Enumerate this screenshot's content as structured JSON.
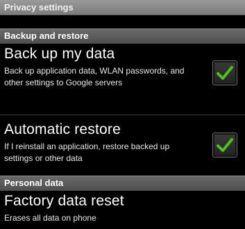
{
  "window": {
    "title": "Privacy settings"
  },
  "sections": [
    {
      "label": "Backup and restore"
    },
    {
      "label": "Personal data"
    }
  ],
  "prefs": {
    "backup": {
      "title": "Back up my data",
      "summary": "Back up application data, WLAN passwords, and other settings to Google servers",
      "checked": true
    },
    "restore": {
      "title": "Automatic restore",
      "summary": "If I reinstall an application, restore backed up settings or other data",
      "checked": true
    },
    "factory": {
      "title": "Factory data reset",
      "summary": "Erases all data on phone"
    }
  },
  "colors": {
    "check": "#4cc31c",
    "background": "#000000"
  }
}
